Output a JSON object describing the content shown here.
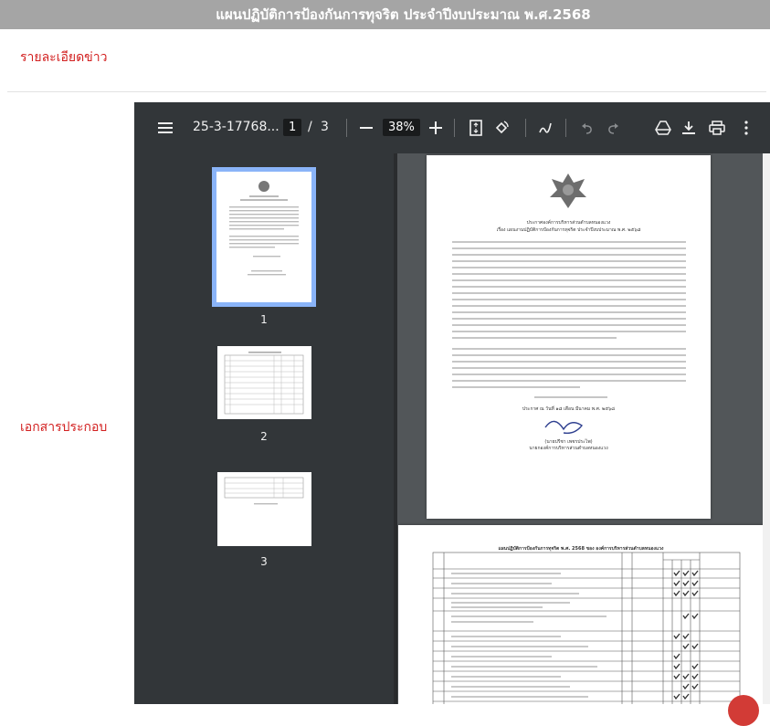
{
  "header": {
    "title": "แผนปฏิบัติการป้องกันการทุจริต ประจำปีงบประมาณ พ.ศ.2568"
  },
  "sections": {
    "detail_label": "รายละเอียดข่าว",
    "attachment_label": "เอกสารประกอบ"
  },
  "viewer": {
    "filename": "25-3-17768...",
    "page_current": "1",
    "page_separator": "/",
    "page_total": "3",
    "zoom": "38%",
    "thumbnails": [
      {
        "number": "1"
      },
      {
        "number": "2"
      },
      {
        "number": "3"
      }
    ]
  },
  "document": {
    "page1_heading": "ประกาศองค์การบริหารส่วนตำบลหนองแวง",
    "page1_subject": "เรื่อง แผนงานปฏิบัติการป้องกันการทุจริต ประจำปีงบประมาณ พ.ศ. ๒๕๖๘",
    "page1_date": "ประกาศ ณ วันที่ ๑๘ เดือน มีนาคม พ.ศ. ๒๕๖๘",
    "page1_signer": "(นายปรีชา เพชรประไพ)",
    "page1_position": "นายกองค์การบริหารส่วนตำบลหนองแวง",
    "page2_title": "แผนปฏิบัติการป้องกันการทุจริต พ.ศ. 2568 ของ องค์การบริหารส่วนตำบลหนองแวง"
  },
  "icons": {
    "menu": "menu-icon",
    "zoom_out": "minus-icon",
    "zoom_in": "plus-icon",
    "fit": "fit-page-icon",
    "rotate": "rotate-icon",
    "annotate": "pen-icon",
    "undo": "undo-icon",
    "redo": "redo-icon",
    "drive": "drive-icon",
    "download": "download-icon",
    "print": "print-icon",
    "more": "more-vert-icon"
  },
  "colors": {
    "header_bg": "#a5a5a5",
    "label_red": "#d21f1f",
    "toolbar_bg": "#323639",
    "viewer_bg": "#525659",
    "active_thumb": "#8ab4f8"
  }
}
